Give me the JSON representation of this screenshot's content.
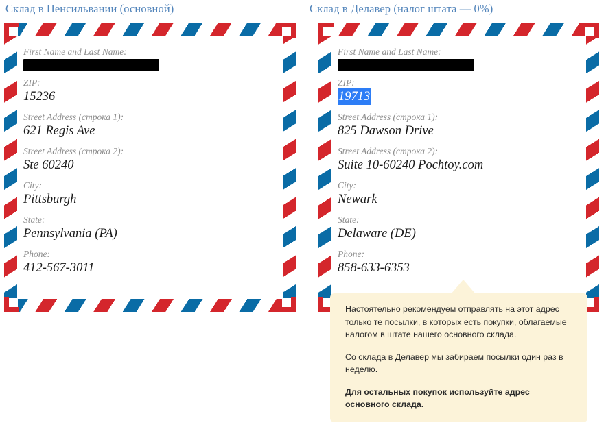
{
  "colors": {
    "airmail_red": "#d4262c",
    "airmail_blue": "#0a6ca6",
    "title_blue": "#5385bb",
    "tooltip_bg": "#fcf3d9",
    "selection_blue": "#2d7df6",
    "label_gray": "#8e8e8e"
  },
  "panels": [
    {
      "title": "Склад в Пенсильвании (основной)",
      "fields": [
        {
          "label": "First Name and Last Name:",
          "value": "",
          "state": "redacted",
          "redaction_width": 194
        },
        {
          "label": "ZIP:",
          "value": "15236",
          "state": "normal"
        },
        {
          "label": "Street Address (строка 1):",
          "value": "621 Regis Ave",
          "state": "normal"
        },
        {
          "label": "Street Address (строка 2):",
          "value": "Ste 60240",
          "state": "normal"
        },
        {
          "label": "City:",
          "value": "Pittsburgh",
          "state": "normal"
        },
        {
          "label": "State:",
          "value": "Pennsylvania (PA)",
          "state": "normal"
        },
        {
          "label": "Phone:",
          "value": "412-567-3011",
          "state": "normal"
        }
      ]
    },
    {
      "title": "Склад в Делавер (налог штата — 0%)",
      "fields": [
        {
          "label": "First Name and Last Name:",
          "value": "",
          "state": "redacted",
          "redaction_width": 195
        },
        {
          "label": "ZIP:",
          "value": "19713",
          "state": "selected"
        },
        {
          "label": "Street Address (строка 1):",
          "value": "825 Dawson Drive",
          "state": "normal"
        },
        {
          "label": "Street Address (строка 2):",
          "value": "Suite 10-60240 Pochtoy.com",
          "state": "normal"
        },
        {
          "label": "City:",
          "value": "Newark",
          "state": "normal"
        },
        {
          "label": "State:",
          "value": "Delaware (DE)",
          "state": "normal"
        },
        {
          "label": "Phone:",
          "value": "858-633-6353",
          "state": "normal"
        }
      ]
    }
  ],
  "tooltip": {
    "paragraphs": [
      {
        "text": "Настоятельно рекомендуем отправлять на этот адрес только те посылки, в которых есть покупки, облагаемые налогом в штате нашего основного склада.",
        "bold": false
      },
      {
        "text": "Со склада в Делавер мы забираем посылки один раз в неделю.",
        "bold": false
      },
      {
        "text": "Для остальных покупок используйте адрес основного склада.",
        "bold": true
      }
    ]
  }
}
